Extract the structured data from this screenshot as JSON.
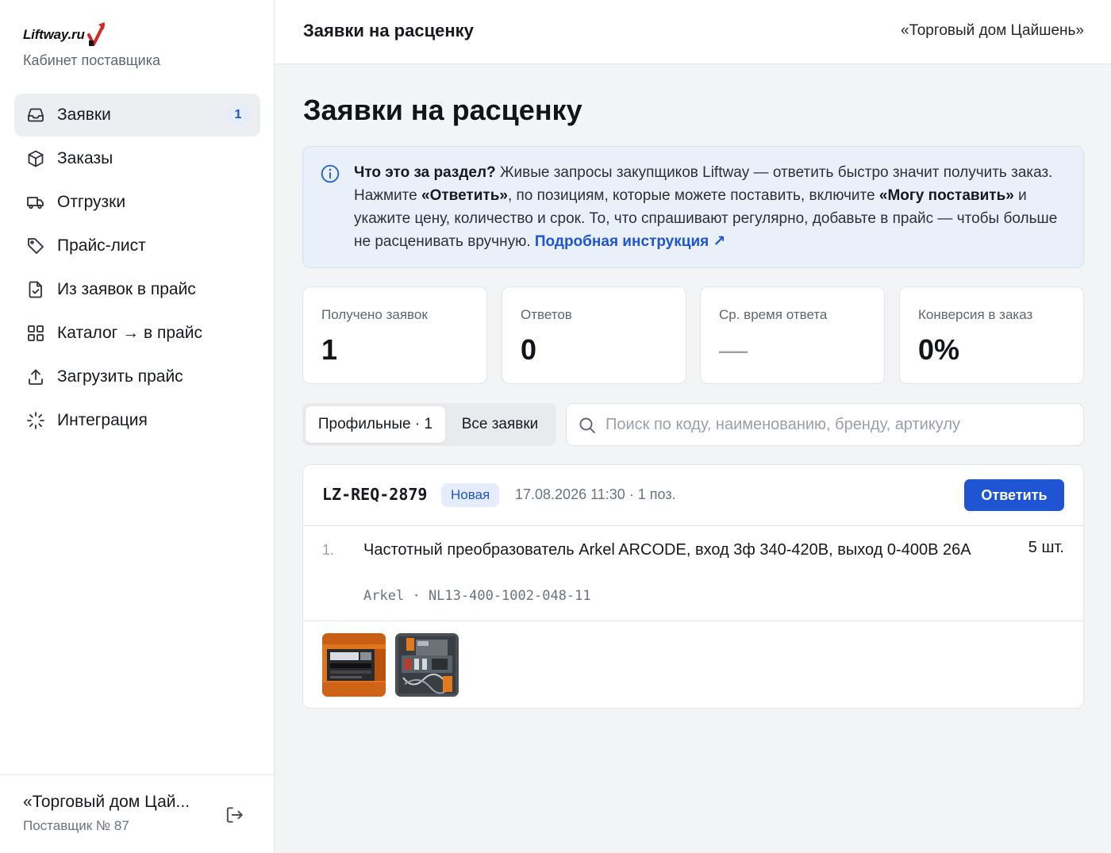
{
  "brand": {
    "logo_text": "Liftway.ru",
    "subtitle": "Кабинет поставщика"
  },
  "sidebar": {
    "items": [
      {
        "label": "Заявки",
        "icon": "inbox-icon",
        "badge": "1",
        "active": true
      },
      {
        "label": "Заказы",
        "icon": "box-icon"
      },
      {
        "label": "Отгрузки",
        "icon": "truck-icon"
      },
      {
        "label": "Прайс-лист",
        "icon": "tag-icon"
      },
      {
        "label": "Из заявок в прайс",
        "icon": "file-check-icon"
      },
      {
        "label": "Каталог → в прайс",
        "icon": "grid-icon"
      },
      {
        "label": "Загрузить прайс",
        "icon": "upload-icon"
      },
      {
        "label": "Интеграция",
        "icon": "loader-icon"
      }
    ],
    "footer": {
      "company": "«Торговый дом Цай...",
      "supplier_id": "Поставщик № 87"
    }
  },
  "topbar": {
    "title": "Заявки на расценку",
    "company": "«Торговый дом Цайшень»"
  },
  "main": {
    "title": "Заявки на расценку",
    "info": {
      "question": "Что это за раздел?",
      "t1": " Живые запросы закупщиков Liftway — ответить быстро значит получить заказ. Нажмите ",
      "b1": "«Ответить»",
      "t2": ", по позициям, которые можете поставить, включите ",
      "b2": "«Могу поставить»",
      "t3": " и укажите цену, количество и срок. То, что спрашивают регулярно, добавьте в прайс — чтобы больше не расценивать вручную. ",
      "link": "Подробная инструкция",
      "link_arrow": "↗"
    },
    "stats": [
      {
        "label": "Получено заявок",
        "value": "1"
      },
      {
        "label": "Ответов",
        "value": "0"
      },
      {
        "label": "Ср. время ответа",
        "value": "—"
      },
      {
        "label": "Конверсия в заказ",
        "value": "0%"
      }
    ],
    "filters": {
      "tab_profile": "Профильные · 1",
      "tab_all": "Все заявки",
      "active": "profile"
    },
    "search": {
      "placeholder": "Поиск по коду, наименованию, бренду, артикулу",
      "value": ""
    },
    "request": {
      "id": "LZ-REQ-2879",
      "status": "Новая",
      "meta": "17.08.2026 11:30 · 1 поз.",
      "reply_label": "Ответить",
      "items": [
        {
          "num": "1.",
          "name": "Частотный преобразователь Arkel ARCODE, вход 3ф 340-420В, выход 0-400В 26А",
          "qty": "5 шт.",
          "brand": "Arkel",
          "sep": "·",
          "article": "NL13-400-1002-048-11"
        }
      ],
      "photos": 2
    }
  },
  "colors": {
    "accent": "#1f55d3",
    "info_bg": "#e9f0fa",
    "badge_bg": "#e5ecfb",
    "logo_red": "#d7261e"
  }
}
